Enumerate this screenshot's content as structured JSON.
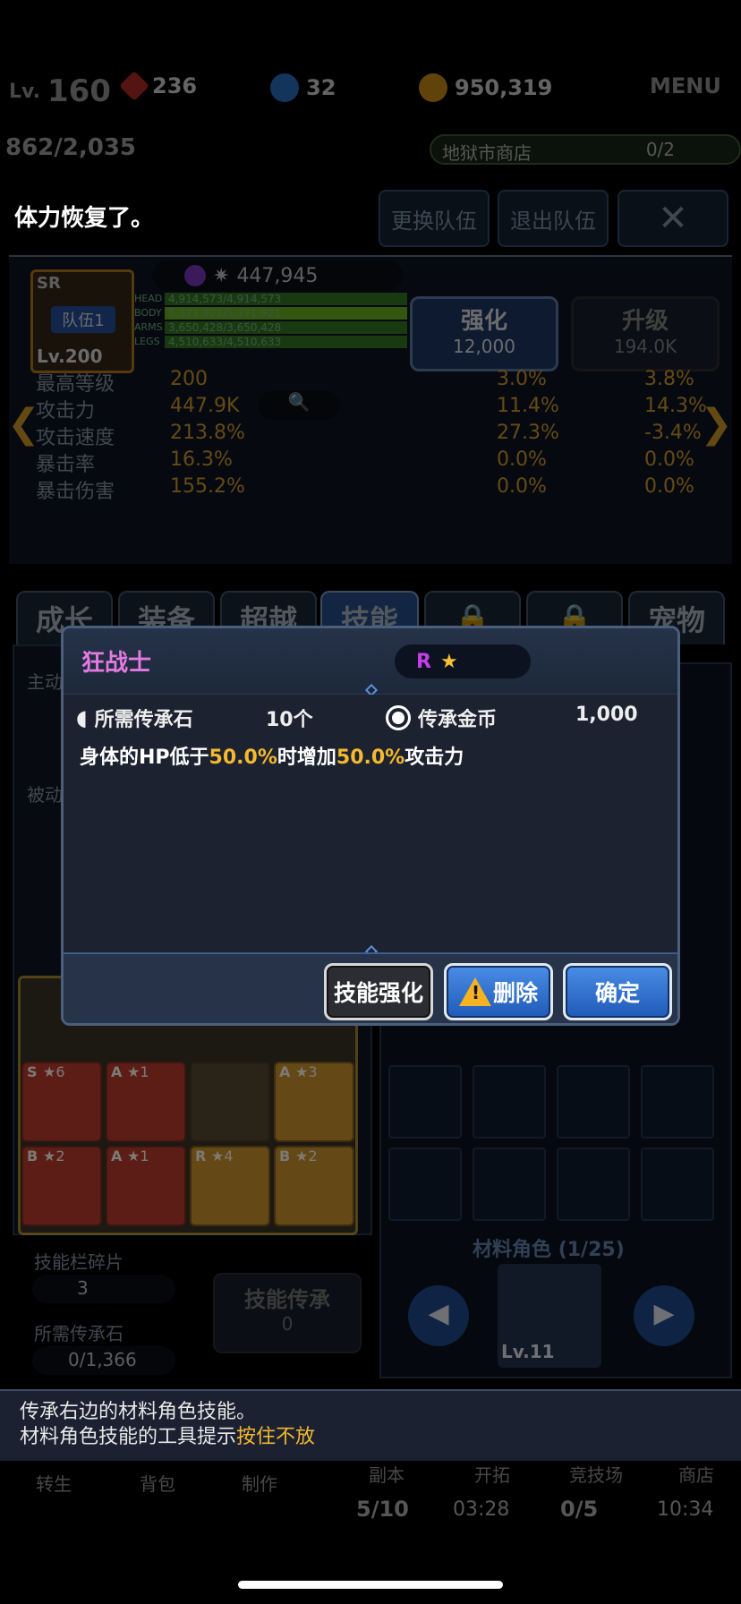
{
  "status": {
    "level_prefix": "Lv.",
    "level": "160",
    "gems": "236",
    "shards": "32",
    "gold": "950,319",
    "menu": "MENU",
    "stamina": "862/2,035",
    "shop_label": "地狱市商店",
    "shop_progress": "0/2"
  },
  "toast": "体力恢复了。",
  "team_buttons": {
    "change": "更换队伍",
    "leave": "退出队伍"
  },
  "hero": {
    "rarity": "SR",
    "team": "队伍1",
    "level": "Lv.200",
    "power": "447,945",
    "hp": [
      {
        "tag": "HEAD",
        "value": "4,914,573/4,914,573"
      },
      {
        "tag": "BODY",
        "value": "5,371,921/5,371,921"
      },
      {
        "tag": "ARMS",
        "value": "3,650,428/3,650,428"
      },
      {
        "tag": "LEGS",
        "value": "4,510,633/4,510,633"
      }
    ],
    "enhance_label": "强化",
    "enhance_cost": "12,000",
    "upgrade_label": "升级",
    "upgrade_cost": "194.0K"
  },
  "stats": [
    {
      "label": "最高等级",
      "value": "200"
    },
    {
      "label": "攻击力",
      "value": "447.9K"
    },
    {
      "label": "攻击速度",
      "value": "213.8%"
    },
    {
      "label": "暴击率",
      "value": "16.3%"
    },
    {
      "label": "暴击伤害",
      "value": "155.2%"
    }
  ],
  "elements_left": [
    "3.0%",
    "11.4%",
    "27.3%",
    "0.0%",
    "0.0%"
  ],
  "elements_right": [
    "3.8%",
    "14.3%",
    "-3.4%",
    "0.0%",
    "0.0%"
  ],
  "tabs": [
    "成长",
    "装备",
    "超越",
    "技能",
    "",
    "",
    "宠物"
  ],
  "skills_panel": {
    "active_label": "主动",
    "passive_label": "被动",
    "fragments_label": "技能栏碎片",
    "fragments": "3",
    "stones_label": "所需传承石",
    "stones": "0/1,366",
    "inherit_button": "技能传承",
    "inherit_cost": "0",
    "material_label": "材料角色",
    "material_count": "(1/25)",
    "material_level": "Lv.11"
  },
  "skill_badges": [
    {
      "grade": "S",
      "stars": "★6"
    },
    {
      "grade": "A",
      "stars": "★1"
    },
    {
      "grade": "A",
      "stars": "★3"
    },
    {
      "grade": "B",
      "stars": "★2"
    },
    {
      "grade": "A",
      "stars": "★1"
    },
    {
      "grade": "R",
      "stars": "★4"
    },
    {
      "grade": "B",
      "stars": "★2"
    }
  ],
  "modal": {
    "title": "狂战士",
    "rarity": "R",
    "stone_label": "所需传承石",
    "stone_value": "10个",
    "coin_label": "传承金币",
    "coin_value": "1,000",
    "desc_a": "身体的HP低于",
    "desc_b": "50.0%",
    "desc_c": "时增加",
    "desc_d": "50.0%",
    "desc_e": "攻击力",
    "btn_enhance": "技能强化",
    "btn_delete": "删除",
    "btn_confirm": "确定"
  },
  "info": {
    "line1": "传承右边的材料角色技能。",
    "line2_a": "材料角色技能的工具提示",
    "line2_b": "按住不放"
  },
  "bottom_nav": {
    "items": [
      "转生",
      "背包",
      "制作",
      "副本",
      "开拓",
      "竞技场",
      "商店"
    ],
    "counter1": "5/10",
    "time1": "03:28",
    "counter2": "0/5",
    "time2": "10:34"
  }
}
